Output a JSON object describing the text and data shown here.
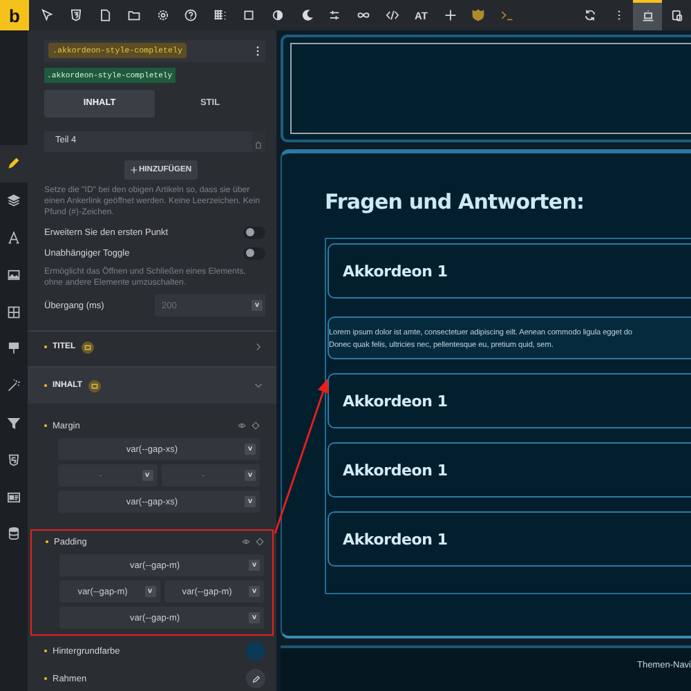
{
  "toolbar": {
    "logo": "b",
    "icons": [
      {
        "kind": "cursor",
        "selected": false
      },
      {
        "kind": "badge3",
        "selected": false
      },
      {
        "kind": "page",
        "selected": false
      },
      {
        "kind": "folder",
        "selected": false
      },
      {
        "kind": "gear",
        "selected": false
      },
      {
        "kind": "help",
        "selected": false
      },
      {
        "kind": "grid",
        "selected": false
      },
      {
        "kind": "square",
        "selected": false
      },
      {
        "kind": "contrast",
        "selected": false
      },
      {
        "kind": "moon",
        "selected": false
      },
      {
        "kind": "sliders",
        "selected": false
      },
      {
        "kind": "infinity",
        "selected": false
      },
      {
        "kind": "code",
        "selected": false
      },
      {
        "kind": "text",
        "label": "AT",
        "selected": false
      },
      {
        "kind": "plus",
        "selected": false
      },
      {
        "kind": "shield",
        "selected": false
      },
      {
        "kind": "terminal",
        "selected": false
      }
    ],
    "right_icons": [
      {
        "kind": "refresh",
        "selected": false
      },
      {
        "kind": "kebab",
        "selected": false
      },
      {
        "kind": "laptop",
        "selected": true
      },
      {
        "kind": "tablet",
        "selected": false
      }
    ]
  },
  "rail": [
    {
      "kind": "pencil",
      "selected": true
    },
    {
      "kind": "layers",
      "selected": false
    },
    {
      "kind": "font",
      "selected": false
    },
    {
      "kind": "image",
      "selected": false
    },
    {
      "kind": "grid4",
      "selected": false
    },
    {
      "kind": "brush",
      "selected": false
    },
    {
      "kind": "wand",
      "selected": false
    },
    {
      "kind": "filter",
      "selected": false
    },
    {
      "kind": "html5",
      "selected": false
    },
    {
      "kind": "card",
      "selected": false
    },
    {
      "kind": "database",
      "selected": false
    }
  ],
  "panel": {
    "class_selector": ".akkordeon-style-completely",
    "class_tag": ".akkordeon-style-completely",
    "tabs": [
      {
        "label": "INHALT",
        "selected": true
      },
      {
        "label": "STIL",
        "selected": false
      }
    ],
    "item_field": "Teil 4",
    "add_button": "HINZUFÜGEN",
    "id_help": "Setze die \"ID\" bei den obigen Artikeln so, dass sie über einen Ankerlink geöffnet werden. Keine Leerzeichen. Kein Pfund (#)-Zeichen.",
    "toggles": [
      {
        "label": "Erweitern Sie den ersten Punkt",
        "on": false
      },
      {
        "label": "Unabhängiger Toggle",
        "on": false
      }
    ],
    "toggle_help": "Ermöglicht das Öffnen und Schließen eines Elements, ohne andere Elemente umzuschalten.",
    "transition": {
      "label": "Übergang (ms)",
      "placeholder": "200",
      "caret": "v"
    },
    "sections": [
      {
        "label": "TITEL",
        "expanded": false
      },
      {
        "label": "INHALT",
        "expanded": true
      }
    ],
    "spacing_groups": [
      {
        "label": "Margin",
        "highlighted": false,
        "fields": [
          {
            "value": "var(--gap-xs)",
            "caret": "v"
          },
          {
            "placeholder": "-",
            "caret": "v"
          },
          {
            "placeholder": "-",
            "caret": "v"
          },
          {
            "value": "var(--gap-xs)",
            "caret": "v"
          }
        ]
      },
      {
        "label": "Padding",
        "highlighted": true,
        "fields": [
          {
            "value": "var(--gap-m)",
            "caret": "v"
          },
          {
            "value": "var(--gap-m)",
            "caret": "v"
          },
          {
            "value": "var(--gap-m)",
            "caret": "v"
          },
          {
            "value": "var(--gap-m)",
            "caret": "v"
          }
        ]
      }
    ],
    "background": {
      "label": "Hintergrundfarbe",
      "color": "#0a3a55"
    },
    "border": {
      "label": "Rahmen"
    }
  },
  "canvas": {
    "heading": "Fragen und Antworten:",
    "accordion": [
      {
        "title": "Akkordeon 1",
        "expanded": false
      },
      {
        "expanded": true,
        "content": [
          "Lorem ipsum dolor ist amte, consectetuer adipiscing eilt. Aenean commodo ligula egget do",
          "Donec quak felis, ultricies nec, pellentesque eu, pretium quid, sem."
        ]
      },
      {
        "title": "Akkordeon 1",
        "expanded": false
      },
      {
        "title": "Akkordeon 1",
        "expanded": false
      },
      {
        "title": "Akkordeon 1",
        "expanded": false
      }
    ],
    "footer_link": "Themen-Navi"
  }
}
